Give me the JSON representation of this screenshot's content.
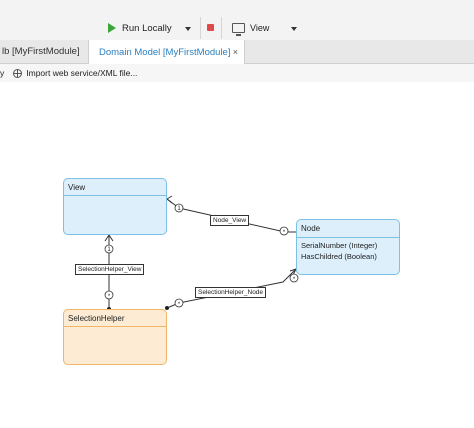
{
  "toolbar": {
    "run_label": "Run Locally",
    "view_label": "View",
    "run_color": "#3aa63a",
    "stop_color": "#e04a4a"
  },
  "tabs": [
    {
      "label": "lb [MyFirstModule]",
      "active": false
    },
    {
      "label": "Domain Model [MyFirstModule]",
      "active": true,
      "close": "×"
    }
  ],
  "subbar": {
    "left_fragment": "y",
    "import_label": "Import web service/XML file..."
  },
  "entities": {
    "view": {
      "name": "View"
    },
    "node": {
      "name": "Node",
      "attributes": [
        "SerialNumber (Integer)",
        "HasChildred (Boolean)"
      ]
    },
    "selection_helper": {
      "name": "SelectionHelper"
    }
  },
  "associations": {
    "node_view": {
      "label": "Node_View",
      "from_multiplicity": "*",
      "to_multiplicity": "1"
    },
    "selection_helper_view": {
      "label": "SelectionHelper_View",
      "from_multiplicity": "*",
      "to_multiplicity": "1"
    },
    "selection_helper_node": {
      "label": "SelectionHelper_Node",
      "from_multiplicity": "*",
      "to_multiplicity": "*"
    }
  },
  "colors": {
    "persistent_fill": "#dceffb",
    "persistent_border": "#7cc0e6",
    "nonpersistent_fill": "#fdebd3",
    "nonpersistent_border": "#f0b668",
    "active_tab_text": "#2a7fbf"
  }
}
